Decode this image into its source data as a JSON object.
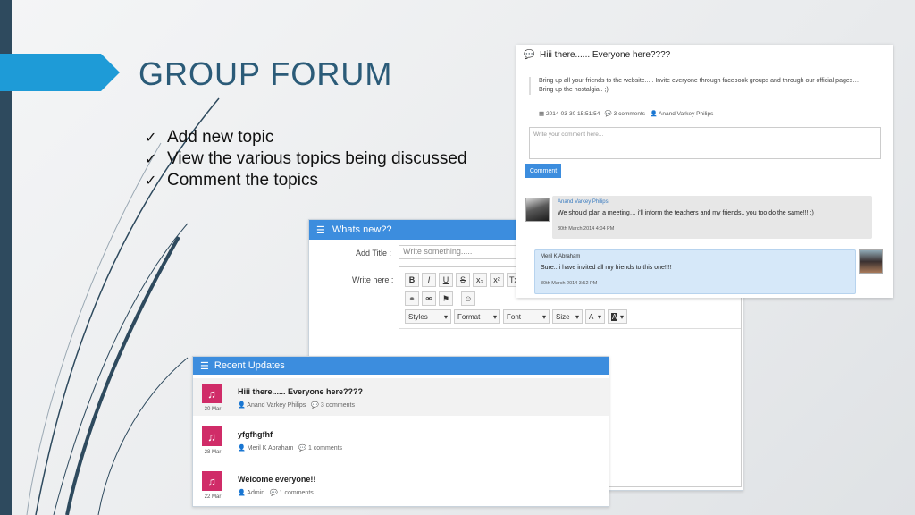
{
  "slide": {
    "title": "GROUP FORUM",
    "bullets": [
      "Add new topic",
      "View the various topics being discussed",
      "Comment the topics"
    ]
  },
  "whats_new": {
    "header": "Whats new??",
    "add_title_label": "Add Title :",
    "title_placeholder": "Write something.....",
    "write_here_label": "Write here :",
    "toolbar": {
      "bold": "B",
      "italic": "I",
      "underline": "U",
      "strike": "S",
      "subscript": "x₂",
      "superscript": "x²",
      "remove_format": "Tx",
      "styles": "Styles",
      "format": "Format",
      "font": "Font",
      "size": "Size",
      "text_color": "A",
      "bg_color": "A"
    }
  },
  "recent_updates": {
    "header": "Recent Updates",
    "items": [
      {
        "title": "Hiii there...... Everyone here????",
        "author": "Anand Varkey Philips",
        "comments": "3 comments",
        "date": "30 Mar"
      },
      {
        "title": "yfgfhgfhf",
        "author": "Meril K Abraham",
        "comments": "1 comments",
        "date": "28 Mar"
      },
      {
        "title": "Welcome everyone!!",
        "author": "Admin",
        "comments": "1 comments",
        "date": "22 Mar"
      }
    ]
  },
  "topic": {
    "title": "Hiii there...... Everyone here????",
    "body_line1": "Bring up all your friends to the website..... Invite everyone through facebook groups and through our official pages…",
    "body_line2": "Bring up the nostalgia.. ;)",
    "timestamp": "2014-03-30 15:51:54",
    "comments": "3 comments",
    "author": "Anand Varkey Philips",
    "comment_placeholder": "Write your comment here...",
    "comment_button": "Comment",
    "messages": [
      {
        "name": "Anand Varkey Philips",
        "text": "We should plan a meeting… i'll inform the teachers and my friends.. you too do the same!!! ;)",
        "date": "30th March 2014 4:04 PM"
      },
      {
        "name": "Meril K Abraham",
        "text": "Sure.. i have invited all my friends to this one!!!!",
        "date": "30th March 2014 3:52 PM"
      }
    ]
  },
  "colors": {
    "accent": "#3c8dde",
    "title": "#2b5b78",
    "icon_pink": "#d02c68",
    "arrow": "#1e9bd7"
  }
}
